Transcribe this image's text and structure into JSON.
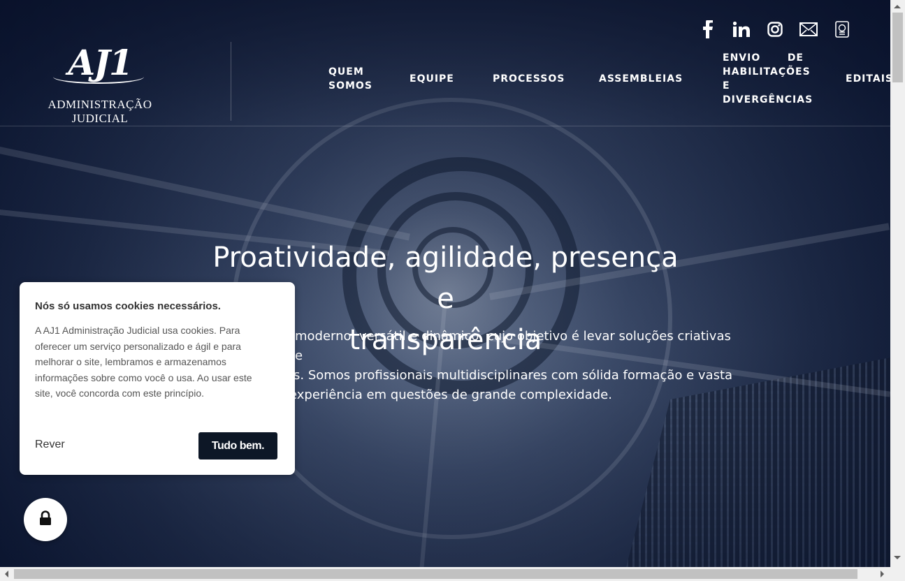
{
  "header": {
    "logo": {
      "mark": "AJ1",
      "text": "ADMINISTRAÇÃO JUDICIAL"
    },
    "social": [
      {
        "icon": "facebook-icon"
      },
      {
        "icon": "linkedin-icon"
      },
      {
        "icon": "instagram-icon"
      },
      {
        "icon": "mail-icon"
      },
      {
        "icon": "document-icon"
      }
    ],
    "nav": {
      "quem_somos_1": "QUEM",
      "quem_somos_2": "SOMOS",
      "equipe": "EQUIPE",
      "processos": "PROCESSOS",
      "assembleias": "ASSEMBLEIAS",
      "envio_1": "ENVIO",
      "envio_de": "DE",
      "envio_2": "HABILITAÇÕES",
      "envio_3": "E",
      "envio_4": "DIVERGÊNCIAS",
      "editais": "EDITAIS"
    }
  },
  "hero": {
    "title_line1": "Proatividade, agilidade, presença e",
    "title_line2": "transparência",
    "text_line1": "moderno, versátil e dinâmico, cujo objetivo é levar soluções criativas e",
    "text_line2": "s. Somos profissionais multidisciplinares com sólida formação e vasta",
    "text_line3": "experiência em questões de grande complexidade."
  },
  "cookie": {
    "title": "Nós só usamos cookies necessários.",
    "body": "A AJ1 Administração Judicial usa cookies. Para oferecer um serviço personalizado e ágil e para melhorar o site, lembramos e armazenamos informações sobre como você o usa. Ao usar este site, você concorda com este princípio.",
    "review_label": "Rever",
    "accept_label": "Tudo bem."
  },
  "colors": {
    "accent_dark": "#0d1726",
    "hero_base": "#0e1830",
    "text_light": "#ffffff"
  }
}
